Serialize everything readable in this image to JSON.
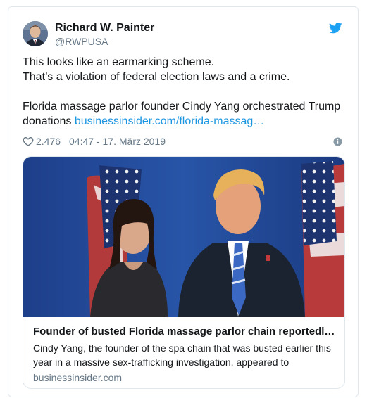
{
  "author": {
    "name": "Richard W. Painter",
    "handle": "@RWPUSA"
  },
  "tweet": {
    "lines": [
      "This looks like an earmarking scheme.",
      "That’s a violation of federal election laws and a crime."
    ],
    "line3": "Florida massage parlor founder Cindy Yang orchestrated Trump",
    "line4_prefix": "donations",
    "link_text": "businessinsider.com/florida-massag…"
  },
  "meta": {
    "likes": "2.476",
    "timestamp": "04:47 - 17. März 2019"
  },
  "link_card": {
    "title": "Founder of busted Florida massage parlor chain reportedly or…",
    "description": "Cindy Yang, the founder of the spa chain that was busted earlier this year in a massive sex-trafficking investigation, appeared to",
    "domain": "businessinsider.com"
  },
  "colors": {
    "link": "#1b95e0",
    "muted": "#657786",
    "border": "#e1e8ed",
    "twitter_blue": "#1da1f2"
  },
  "icons": [
    "twitter-bird-icon",
    "heart-icon",
    "info-icon"
  ]
}
